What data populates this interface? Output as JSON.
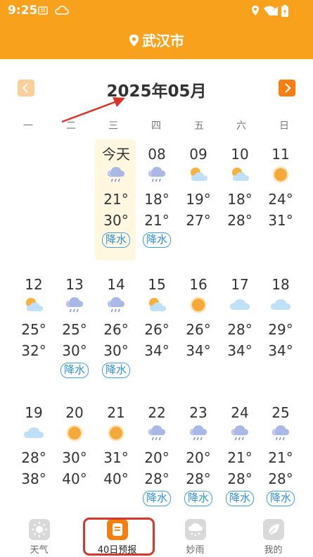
{
  "status_bar": {
    "time": "9:25"
  },
  "header": {
    "city": "武汉市"
  },
  "calendar": {
    "month_title": "2025年05月",
    "weekdays": [
      "一",
      "二",
      "三",
      "四",
      "五",
      "六",
      "日"
    ],
    "rows": [
      [
        {
          "day": "今天",
          "icon": "rain-cloud-icon",
          "low": "21°",
          "high": "30°",
          "tag": "降水"
        },
        {
          "day": "08",
          "icon": "rain-cloud-icon",
          "low": "18°",
          "high": "21°",
          "tag": "降水"
        },
        {
          "day": "09",
          "icon": "partly-cloudy-icon",
          "low": "19°",
          "high": "27°",
          "tag": ""
        },
        {
          "day": "10",
          "icon": "partly-cloudy-icon",
          "low": "18°",
          "high": "28°",
          "tag": ""
        },
        {
          "day": "11",
          "icon": "sun-icon",
          "low": "24°",
          "high": "31°",
          "tag": ""
        }
      ],
      [
        {
          "day": "12",
          "icon": "partly-cloudy-icon",
          "low": "25°",
          "high": "32°",
          "tag": ""
        },
        {
          "day": "13",
          "icon": "rain-cloud-icon",
          "low": "25°",
          "high": "30°",
          "tag": "降水"
        },
        {
          "day": "14",
          "icon": "rain-cloud-icon",
          "low": "26°",
          "high": "30°",
          "tag": "降水"
        },
        {
          "day": "15",
          "icon": "partly-cloudy-icon",
          "low": "26°",
          "high": "34°",
          "tag": ""
        },
        {
          "day": "16",
          "icon": "sun-icon",
          "low": "26°",
          "high": "34°",
          "tag": ""
        },
        {
          "day": "17",
          "icon": "cloud-icon",
          "low": "28°",
          "high": "34°",
          "tag": ""
        },
        {
          "day": "18",
          "icon": "cloud-icon",
          "low": "29°",
          "high": "34°",
          "tag": ""
        }
      ],
      [
        {
          "day": "19",
          "icon": "cloud-icon",
          "low": "28°",
          "high": "38°",
          "tag": ""
        },
        {
          "day": "20",
          "icon": "sun-icon",
          "low": "30°",
          "high": "40°",
          "tag": ""
        },
        {
          "day": "21",
          "icon": "sun-icon",
          "low": "31°",
          "high": "40°",
          "tag": ""
        },
        {
          "day": "22",
          "icon": "rain-cloud-icon",
          "low": "20°",
          "high": "28°",
          "tag": "降水"
        },
        {
          "day": "23",
          "icon": "rain-cloud-icon",
          "low": "20°",
          "high": "28°",
          "tag": "降水"
        },
        {
          "day": "24",
          "icon": "rain-cloud-icon",
          "low": "21°",
          "high": "28°",
          "tag": "降水"
        },
        {
          "day": "25",
          "icon": "rain-cloud-icon",
          "low": "21°",
          "high": "28°",
          "tag": "降水"
        }
      ]
    ]
  },
  "tabbar": {
    "tabs": [
      {
        "label": "天气",
        "icon": "weather-sun-icon"
      },
      {
        "label": "40日预报",
        "icon": "forecast-calendar-icon"
      },
      {
        "label": "妙雨",
        "icon": "rain-cloud-tab-icon"
      },
      {
        "label": "我的",
        "icon": "leaf-icon"
      }
    ]
  },
  "colors": {
    "brand_orange": "#f8a11c",
    "rain_tag_blue": "#3ea2e6",
    "today_highlight": "#fff7e0",
    "annotation_red": "#d9362b"
  }
}
